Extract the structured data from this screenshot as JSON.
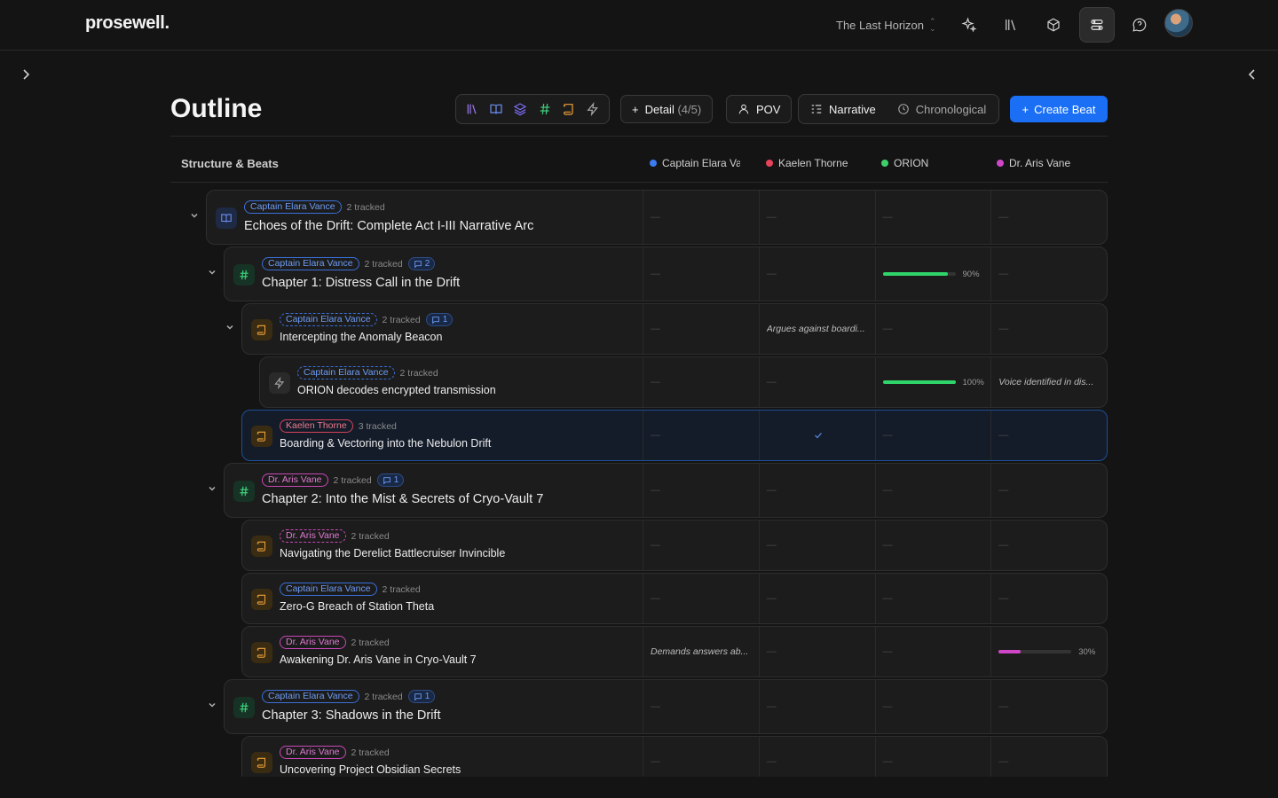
{
  "app": {
    "logo": "prosewell.",
    "project": "The Last Horizon"
  },
  "toolbar_icons": [
    "sparkles-icon",
    "library-icon",
    "cube-icon",
    "settings-sliders-icon",
    "help-icon"
  ],
  "page": {
    "title": "Outline",
    "detail_label": "Detail",
    "detail_count": "(4/5)",
    "pov_label": "POV",
    "view_narrative": "Narrative",
    "view_chronological": "Chronological",
    "create_label": "Create Beat"
  },
  "table": {
    "structure_label": "Structure & Beats",
    "columns": [
      {
        "name": "Captain Elara Vance",
        "color": "#3b7cf0"
      },
      {
        "name": "Kaelen Thorne",
        "color": "#e8435c"
      },
      {
        "name": "ORION",
        "color": "#3ecf6a"
      },
      {
        "name": "Dr. Aris Vane",
        "color": "#d046c8"
      }
    ]
  },
  "rows": [
    {
      "type": "book",
      "pov": "Captain Elara Vance",
      "pov_color": "blue",
      "tracked": "2 tracked",
      "comments": "",
      "title": "Echoes of the Drift: Complete Act I-III Narrative Arc"
    },
    {
      "type": "chapter",
      "pov": "Captain Elara Vance",
      "pov_color": "blue",
      "tracked": "2 tracked",
      "comments": "2",
      "title": "Chapter 1: Distress Call in the Drift",
      "orion_progress": 90,
      "orion_pct": "90%"
    },
    {
      "type": "scene",
      "pov": "Captain Elara Vance",
      "pov_color": "blue",
      "tracked": "2 tracked",
      "comments": "1",
      "title": "Intercepting the Anomaly Beacon",
      "kaelen_note": "Argues against boardi..."
    },
    {
      "type": "beat",
      "pov": "Captain Elara Vance",
      "pov_color": "blue",
      "tracked": "2 tracked",
      "comments": "",
      "title": "ORION decodes encrypted transmission",
      "orion_progress": 100,
      "orion_pct": "100%",
      "aris_note": "Voice identified in dis..."
    },
    {
      "type": "scene",
      "pov": "Kaelen Thorne",
      "pov_color": "red",
      "tracked": "3 tracked",
      "comments": "",
      "title": "Boarding & Vectoring into the Nebulon Drift"
    },
    {
      "type": "chapter",
      "pov": "Dr. Aris Vane",
      "pov_color": "pink",
      "tracked": "2 tracked",
      "comments": "1",
      "title": "Chapter 2: Into the Mist & Secrets of Cryo-Vault 7"
    },
    {
      "type": "scene",
      "pov": "Dr. Aris Vane",
      "pov_color": "pink",
      "tracked": "2 tracked",
      "comments": "",
      "title": "Navigating the Derelict Battlecruiser Invincible"
    },
    {
      "type": "scene",
      "pov": "Captain Elara Vance",
      "pov_color": "blue",
      "tracked": "2 tracked",
      "comments": "",
      "title": "Zero-G Breach of Station Theta"
    },
    {
      "type": "scene",
      "pov": "Dr. Aris Vane",
      "pov_color": "pink",
      "tracked": "2 tracked",
      "comments": "",
      "title": "Awakening Dr. Aris Vane in Cryo-Vault 7",
      "elara_note": "Demands answers ab...",
      "aris_progress": 30,
      "aris_pct": "30%"
    },
    {
      "type": "chapter",
      "pov": "Captain Elara Vance",
      "pov_color": "blue",
      "tracked": "2 tracked",
      "comments": "1",
      "title": "Chapter 3: Shadows in the Drift"
    },
    {
      "type": "scene",
      "pov": "Dr. Aris Vane",
      "pov_color": "pink",
      "tracked": "2 tracked",
      "comments": "",
      "title": "Uncovering Project Obsidian Secrets"
    }
  ],
  "placeholder_dash": "—"
}
